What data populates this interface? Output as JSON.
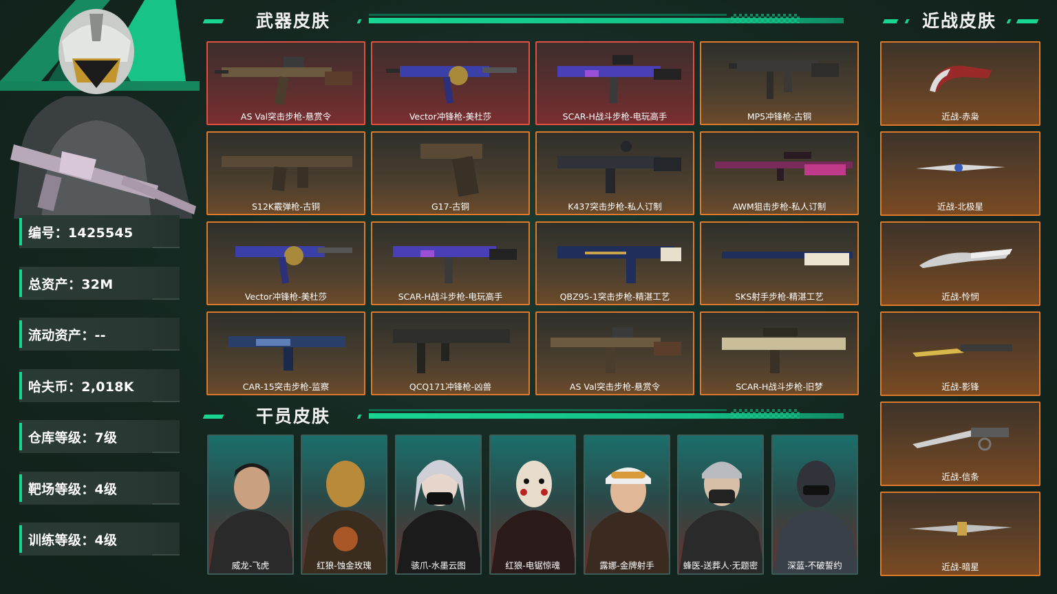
{
  "left": {
    "stats": [
      {
        "label": "编号：1425545"
      },
      {
        "label": "总资产：32M"
      },
      {
        "label": "流动资产：--"
      },
      {
        "label": "哈夫币：2,018K"
      },
      {
        "label": "仓库等级：7级"
      },
      {
        "label": "靶场等级：4级"
      },
      {
        "label": "训练等级：4级"
      }
    ]
  },
  "weapons": {
    "title": "武器皮肤",
    "items": [
      {
        "label": "AS Val突击步枪-悬赏令",
        "rarity": "red"
      },
      {
        "label": "Vector冲锋枪-美杜莎",
        "rarity": "red"
      },
      {
        "label": "SCAR-H战斗步枪-电玩高手",
        "rarity": "red"
      },
      {
        "label": "MP5冲锋枪-古铜",
        "rarity": "gold"
      },
      {
        "label": "S12K霰弹枪-古铜",
        "rarity": "gold"
      },
      {
        "label": "G17-古铜",
        "rarity": "gold"
      },
      {
        "label": "K437突击步枪-私人订制",
        "rarity": "gold"
      },
      {
        "label": "AWM狙击步枪-私人订制",
        "rarity": "gold"
      },
      {
        "label": "Vector冲锋枪-美杜莎",
        "rarity": "gold"
      },
      {
        "label": "SCAR-H战斗步枪-电玩高手",
        "rarity": "gold"
      },
      {
        "label": "QBZ95-1突击步枪-精湛工艺",
        "rarity": "gold"
      },
      {
        "label": "SKS射手步枪-精湛工艺",
        "rarity": "gold"
      },
      {
        "label": "CAR-15突击步枪-监察",
        "rarity": "gold"
      },
      {
        "label": "QCQ171冲锋枪-凶兽",
        "rarity": "gold"
      },
      {
        "label": "AS Val突击步枪-悬赏令",
        "rarity": "gold"
      },
      {
        "label": "SCAR-H战斗步枪-旧梦",
        "rarity": "gold"
      }
    ]
  },
  "operators": {
    "title": "干员皮肤",
    "items": [
      {
        "label": "威龙-飞虎"
      },
      {
        "label": "红狼-蚀金玫瑰"
      },
      {
        "label": "骇爪-水墨云图"
      },
      {
        "label": "红狼-电锯惊魂"
      },
      {
        "label": "露娜-金牌射手"
      },
      {
        "label": "蜂医-送葬人·无题密"
      },
      {
        "label": "深蓝-不破誓约"
      }
    ]
  },
  "melee": {
    "title": "近战皮肤",
    "items": [
      {
        "label": "近战-赤枭"
      },
      {
        "label": "近战-北极星"
      },
      {
        "label": "近战-怜悯"
      },
      {
        "label": "近战-影锋"
      },
      {
        "label": "近战-信条"
      },
      {
        "label": "近战-暗星"
      }
    ]
  },
  "colors": {
    "accent": "#18d592",
    "rare_red": "#e4503f",
    "rare_gold": "#e07a2b",
    "background": "#14261f"
  }
}
